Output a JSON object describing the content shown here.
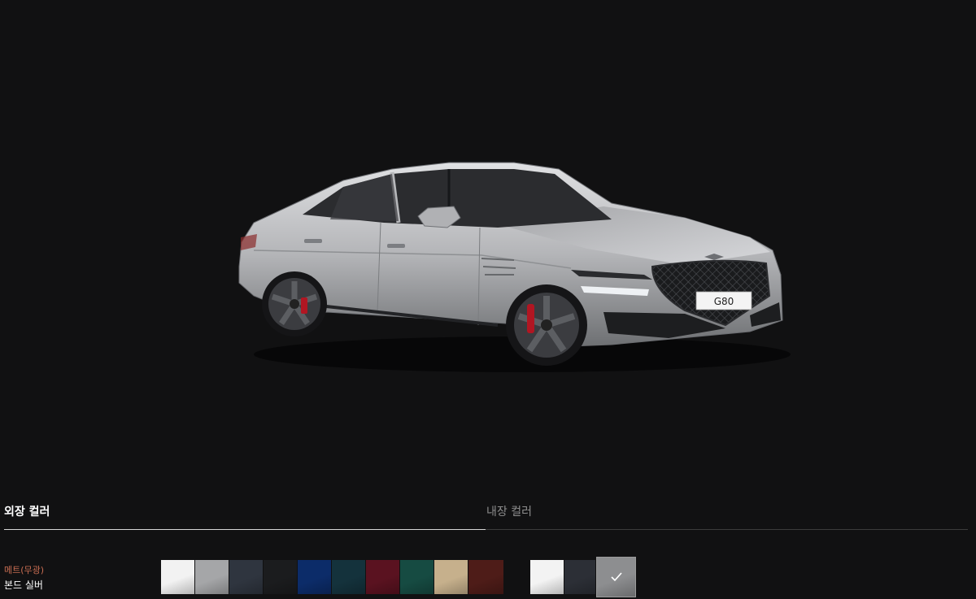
{
  "car": {
    "plate": "G80",
    "body_color": "#b6b7b9"
  },
  "tabs": {
    "exterior_label": "외장 컬러",
    "interior_label": "내장 컬러"
  },
  "selection": {
    "finish": "메트(무광)",
    "color_name": "본드 실버"
  },
  "exterior_swatches": [
    {
      "color": "#f2f2f2"
    },
    {
      "color": "#a5a6a8"
    },
    {
      "color": "#2f353f"
    },
    {
      "color": "#1b1c1e"
    },
    {
      "color": "#0c2c69"
    },
    {
      "color": "#14323c"
    },
    {
      "color": "#5a1220"
    },
    {
      "color": "#164b42"
    },
    {
      "color": "#c6b08c"
    },
    {
      "color": "#4e1c18"
    }
  ],
  "interior_swatches": [
    {
      "color": "#f3f3f3"
    },
    {
      "color": "#2c2f36"
    },
    {
      "color": "#8d8e90",
      "selected": true
    }
  ]
}
